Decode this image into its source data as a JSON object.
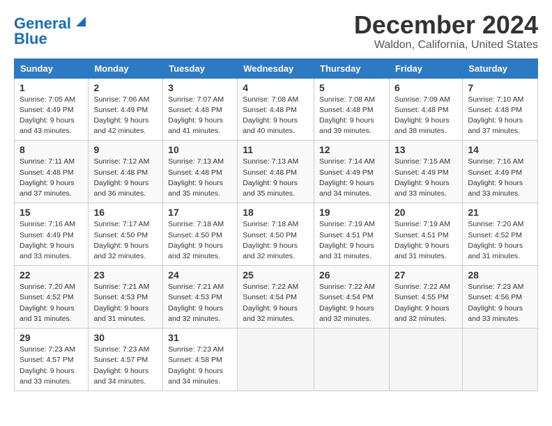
{
  "logo": {
    "line1": "General",
    "line2": "Blue"
  },
  "title": "December 2024",
  "subtitle": "Waldon, California, United States",
  "days_header": [
    "Sunday",
    "Monday",
    "Tuesday",
    "Wednesday",
    "Thursday",
    "Friday",
    "Saturday"
  ],
  "weeks": [
    [
      {
        "day": "1",
        "sunrise": "7:05 AM",
        "sunset": "4:49 PM",
        "daylight": "9 hours and 43 minutes."
      },
      {
        "day": "2",
        "sunrise": "7:06 AM",
        "sunset": "4:49 PM",
        "daylight": "9 hours and 42 minutes."
      },
      {
        "day": "3",
        "sunrise": "7:07 AM",
        "sunset": "4:48 PM",
        "daylight": "9 hours and 41 minutes."
      },
      {
        "day": "4",
        "sunrise": "7:08 AM",
        "sunset": "4:48 PM",
        "daylight": "9 hours and 40 minutes."
      },
      {
        "day": "5",
        "sunrise": "7:08 AM",
        "sunset": "4:48 PM",
        "daylight": "9 hours and 39 minutes."
      },
      {
        "day": "6",
        "sunrise": "7:09 AM",
        "sunset": "4:48 PM",
        "daylight": "9 hours and 38 minutes."
      },
      {
        "day": "7",
        "sunrise": "7:10 AM",
        "sunset": "4:48 PM",
        "daylight": "9 hours and 37 minutes."
      }
    ],
    [
      {
        "day": "8",
        "sunrise": "7:11 AM",
        "sunset": "4:48 PM",
        "daylight": "9 hours and 37 minutes."
      },
      {
        "day": "9",
        "sunrise": "7:12 AM",
        "sunset": "4:48 PM",
        "daylight": "9 hours and 36 minutes."
      },
      {
        "day": "10",
        "sunrise": "7:13 AM",
        "sunset": "4:48 PM",
        "daylight": "9 hours and 35 minutes."
      },
      {
        "day": "11",
        "sunrise": "7:13 AM",
        "sunset": "4:48 PM",
        "daylight": "9 hours and 35 minutes."
      },
      {
        "day": "12",
        "sunrise": "7:14 AM",
        "sunset": "4:49 PM",
        "daylight": "9 hours and 34 minutes."
      },
      {
        "day": "13",
        "sunrise": "7:15 AM",
        "sunset": "4:49 PM",
        "daylight": "9 hours and 33 minutes."
      },
      {
        "day": "14",
        "sunrise": "7:16 AM",
        "sunset": "4:49 PM",
        "daylight": "9 hours and 33 minutes."
      }
    ],
    [
      {
        "day": "15",
        "sunrise": "7:16 AM",
        "sunset": "4:49 PM",
        "daylight": "9 hours and 33 minutes."
      },
      {
        "day": "16",
        "sunrise": "7:17 AM",
        "sunset": "4:50 PM",
        "daylight": "9 hours and 32 minutes."
      },
      {
        "day": "17",
        "sunrise": "7:18 AM",
        "sunset": "4:50 PM",
        "daylight": "9 hours and 32 minutes."
      },
      {
        "day": "18",
        "sunrise": "7:18 AM",
        "sunset": "4:50 PM",
        "daylight": "9 hours and 32 minutes."
      },
      {
        "day": "19",
        "sunrise": "7:19 AM",
        "sunset": "4:51 PM",
        "daylight": "9 hours and 31 minutes."
      },
      {
        "day": "20",
        "sunrise": "7:19 AM",
        "sunset": "4:51 PM",
        "daylight": "9 hours and 31 minutes."
      },
      {
        "day": "21",
        "sunrise": "7:20 AM",
        "sunset": "4:52 PM",
        "daylight": "9 hours and 31 minutes."
      }
    ],
    [
      {
        "day": "22",
        "sunrise": "7:20 AM",
        "sunset": "4:52 PM",
        "daylight": "9 hours and 31 minutes."
      },
      {
        "day": "23",
        "sunrise": "7:21 AM",
        "sunset": "4:53 PM",
        "daylight": "9 hours and 31 minutes."
      },
      {
        "day": "24",
        "sunrise": "7:21 AM",
        "sunset": "4:53 PM",
        "daylight": "9 hours and 32 minutes."
      },
      {
        "day": "25",
        "sunrise": "7:22 AM",
        "sunset": "4:54 PM",
        "daylight": "9 hours and 32 minutes."
      },
      {
        "day": "26",
        "sunrise": "7:22 AM",
        "sunset": "4:54 PM",
        "daylight": "9 hours and 32 minutes."
      },
      {
        "day": "27",
        "sunrise": "7:22 AM",
        "sunset": "4:55 PM",
        "daylight": "9 hours and 32 minutes."
      },
      {
        "day": "28",
        "sunrise": "7:23 AM",
        "sunset": "4:56 PM",
        "daylight": "9 hours and 33 minutes."
      }
    ],
    [
      {
        "day": "29",
        "sunrise": "7:23 AM",
        "sunset": "4:57 PM",
        "daylight": "9 hours and 33 minutes."
      },
      {
        "day": "30",
        "sunrise": "7:23 AM",
        "sunset": "4:57 PM",
        "daylight": "9 hours and 34 minutes."
      },
      {
        "day": "31",
        "sunrise": "7:23 AM",
        "sunset": "4:58 PM",
        "daylight": "9 hours and 34 minutes."
      },
      null,
      null,
      null,
      null
    ]
  ]
}
